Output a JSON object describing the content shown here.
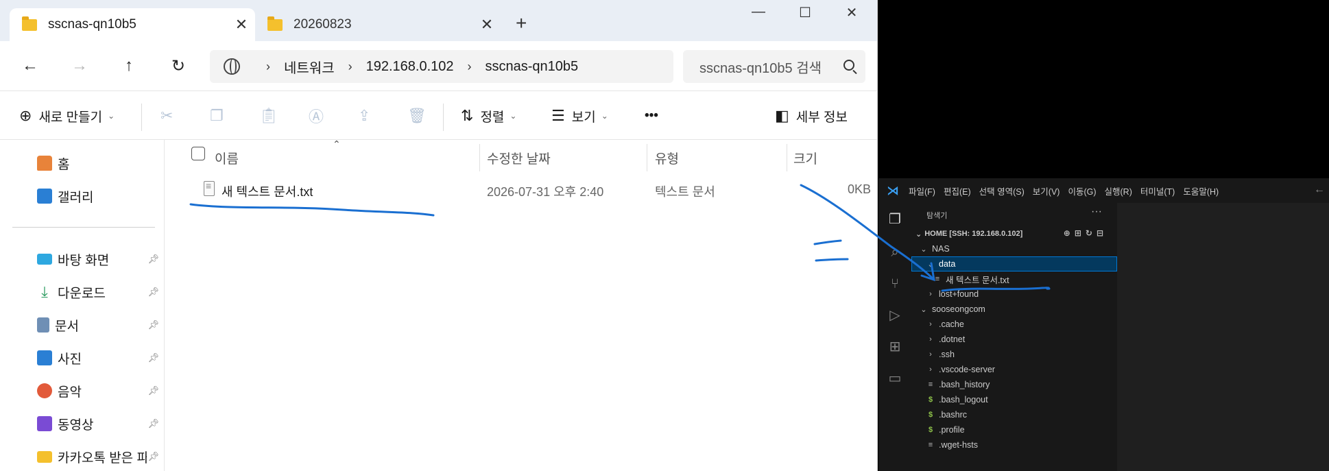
{
  "explorer": {
    "tabs": [
      {
        "title": "sscnas-qn10b5",
        "active": true
      },
      {
        "title": "20260823",
        "active": false
      }
    ],
    "new_tab_label": "+",
    "window_controls": {
      "minimize": "—",
      "maximize": "☐",
      "close": "✕"
    },
    "nav": {
      "back": "←",
      "forward": "→",
      "up": "↑",
      "refresh": "↻"
    },
    "address": {
      "crumbs": [
        "네트워크",
        "192.168.0.102",
        "sscnas-qn10b5"
      ],
      "separator": "›"
    },
    "search": {
      "placeholder": "sscnas-qn10b5 검색"
    },
    "commands": {
      "new": "새로 만들기",
      "sort": "정렬",
      "view": "보기",
      "more": "•••",
      "details": "세부 정보"
    },
    "sidebar": {
      "top": [
        {
          "label": "홈",
          "icon": "home-icon",
          "color": "#e8833a"
        },
        {
          "label": "갤러리",
          "icon": "gallery-icon",
          "color": "#2a7fd4"
        }
      ],
      "pinned": [
        {
          "label": "바탕 화면",
          "icon": "desktop-icon",
          "color": "#2ea8e0"
        },
        {
          "label": "다운로드",
          "icon": "download-icon",
          "color": "#2b9a5f"
        },
        {
          "label": "문서",
          "icon": "document-icon",
          "color": "#6f8fb5"
        },
        {
          "label": "사진",
          "icon": "pictures-icon",
          "color": "#2a7fd4"
        },
        {
          "label": "음악",
          "icon": "music-icon",
          "color": "#e25a3a"
        },
        {
          "label": "동영상",
          "icon": "video-icon",
          "color": "#7a4bd4"
        },
        {
          "label": "카카오톡 받은 파",
          "icon": "folder-icon",
          "color": "#f4c02d"
        }
      ]
    },
    "columns": {
      "name": "이름",
      "modified": "수정한 날짜",
      "type": "유형",
      "size": "크기"
    },
    "files": [
      {
        "name": "새 텍스트 문서.txt",
        "modified": "2026-07-31 오후 2:40",
        "type": "텍스트 문서",
        "size": "0KB"
      }
    ]
  },
  "vscode": {
    "menu": [
      "파일(F)",
      "편집(E)",
      "선택 영역(S)",
      "보기(V)",
      "이동(G)",
      "실행(R)",
      "터미널(T)",
      "도움말(H)"
    ],
    "explorer_title": "탐색기",
    "section": "HOME [SSH: 192.168.0.102]",
    "tree": [
      {
        "label": "NAS",
        "depth": 0,
        "type": "folder-open"
      },
      {
        "label": "data",
        "depth": 1,
        "type": "folder-open",
        "selected": true
      },
      {
        "label": "새 텍스트 문서.txt",
        "depth": 2,
        "type": "file"
      },
      {
        "label": "lost+found",
        "depth": 1,
        "type": "folder"
      },
      {
        "label": "sooseongcom",
        "depth": 0,
        "type": "folder-open"
      },
      {
        "label": ".cache",
        "depth": 1,
        "type": "folder"
      },
      {
        "label": ".dotnet",
        "depth": 1,
        "type": "folder"
      },
      {
        "label": ".ssh",
        "depth": 1,
        "type": "folder"
      },
      {
        "label": ".vscode-server",
        "depth": 1,
        "type": "folder"
      },
      {
        "label": ".bash_history",
        "depth": 1,
        "type": "file"
      },
      {
        "label": ".bash_logout",
        "depth": 1,
        "type": "shell"
      },
      {
        "label": ".bashrc",
        "depth": 1,
        "type": "shell"
      },
      {
        "label": ".profile",
        "depth": 1,
        "type": "shell"
      },
      {
        "label": ".wget-hsts",
        "depth": 1,
        "type": "file"
      }
    ]
  },
  "colors": {
    "annotation": "#1a6fd1",
    "vscode_accent": "#0078d4"
  }
}
